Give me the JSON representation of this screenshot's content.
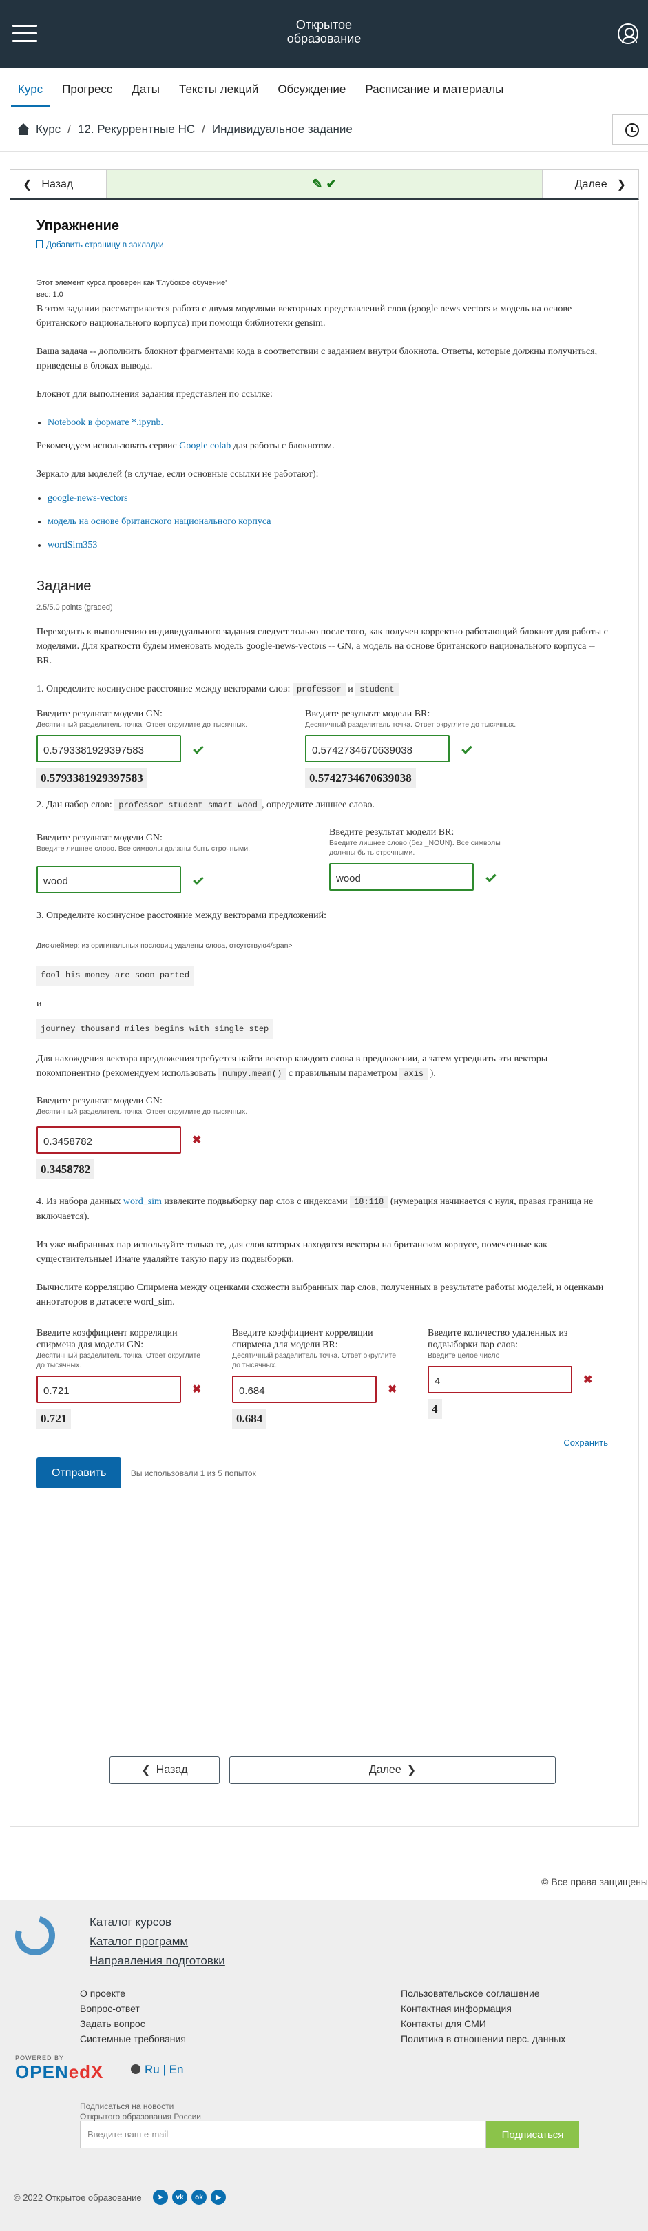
{
  "header": {
    "logo_line1": "Открытое",
    "logo_line2": "образование"
  },
  "course_nav": [
    "Курс",
    "Прогресс",
    "Даты",
    "Тексты лекций",
    "Обсуждение",
    "Расписание и материалы"
  ],
  "breadcrumb": [
    "Курс",
    "12. Рекуррентные НС",
    "Индивидуальное задание"
  ],
  "seq": {
    "prev": "Назад",
    "next": "Далее"
  },
  "exercise": {
    "title": "Упражнение",
    "bookmark": "Добавить страницу в закладки",
    "checked": "Этот элемент курса проверен как 'Глубокое обучение'",
    "weight": "вес: 1.0",
    "p1": "В этом задании рассматривается работа с двумя моделями векторных представлений слов (google news vectors и модель на основе британского национального корпуса) при помощи библиотеки gensim.",
    "p2": "Ваша задача -- дополнить блокнот фрагментами кода в соответствии с заданием внутри блокнота. Ответы, которые должны получиться, приведены в блоках вывода.",
    "p3": "Блокнот для выполнения задания представлен по ссылке:",
    "notebook_link": "Notebook в формате *.ipynb.",
    "p4_a": "Рекомендуем использовать сервис ",
    "p4_link": "Google colab",
    "p4_b": " для работы с блокнотом.",
    "p5": "Зеркало для моделей (в случае, если основные ссылки не работают):",
    "mirrors": [
      "google-news-vectors",
      "модель на основе британского национального корпуса",
      "wordSim353"
    ]
  },
  "task": {
    "title": "Задание",
    "points": "2.5/5.0 points (graded)",
    "intro": "Переходить к выполнению индивидуального задания следует только после того, как получен корректно работающий блокнот для работы с моделями. Для краткости будем именовать модель google-news-vectors -- GN, а модель на основе британского национального корпуса -- BR.",
    "q1": "1. Определите косинусное расстояние между векторами слов:",
    "q1_w1": "professor",
    "q1_and": "и",
    "q1_w2": "student",
    "gn_label": "Введите результат модели GN:",
    "br_label": "Введите результат модели BR:",
    "hint_decimal": "Десятичный разделитель точка. Ответ округлите до тысячных.",
    "q1_gn": "0.5793381929397583",
    "q1_br": "0.5742734670639038",
    "q2_a": "2. Дан набор слов:",
    "q2_words": "professor student smart wood",
    "q2_b": ", определите лишнее слово.",
    "hint_word_gn": "Введите лишнее слово. Все символы должны быть строчными.",
    "hint_word_br": "Введите лишнее слово (без _NOUN). Все символы должны быть строчными.",
    "q2_gn": "wood",
    "q2_br": "wood",
    "q3": "3. Определите косинусное расстояние между векторами предложений:",
    "q3_disclaimer": "Дисклеймер: из оригинальных пословиц удалены слова, отсутствую4/span>",
    "q3_s1": "fool his money are soon parted",
    "q3_and": "и",
    "q3_s2": "journey thousand miles begins with single step",
    "q3_text_a": "Для нахождения вектора предложения требуется найти вектор каждого слова в предложении, а затем усреднить эти векторы покомпонентно (рекомендуем использовать",
    "q3_code1": "numpy.mean()",
    "q3_text_b": "с правильным параметром",
    "q3_code2": "axis",
    "q3_text_c": ").",
    "q3_gn": "0.3458782",
    "q4_a": "4. Из набора данных",
    "q4_link": "word_sim",
    "q4_b": "извлеките подвыборку пар слов с индексами",
    "q4_code": "18:118",
    "q4_c": "(нумерация начинается с нуля, правая граница не включается).",
    "q4_p2": "Из уже выбранных пар используйте только те, для слов которых находятся векторы на британском корпусе, помеченные как существительные! Иначе удаляйте такую пару из подвыборки.",
    "q4_p3": "Вычислите корреляцию Спирмена между оценками схожести выбранных пар слов, полученных в результате работы моделей, и оценками аннотаторов в датасете word_sim.",
    "corr_gn_label": "Введите коэффициент корреляции спирмена для модели GN:",
    "corr_br_label": "Введите коэффициент корреляции спирмена для модели BR:",
    "removed_label": "Введите количество удаленных из подвыборки пар слов:",
    "hint_int": "Введите целое число",
    "q4_gn": "0.721",
    "q4_br": "0.684",
    "q4_removed": "4",
    "save": "Сохранить",
    "submit": "Отправить",
    "attempts": "Вы использовали 1 из 5 попыток"
  },
  "bottom_nav": {
    "prev": "Назад",
    "next": "Далее"
  },
  "footer": {
    "rights": "© Все права защищены",
    "catalog": [
      "Каталог курсов",
      "Каталог программ",
      "Направления подготовки"
    ],
    "col1": [
      "О проекте",
      "Вопрос-ответ",
      "Задать вопрос",
      "Системные требования"
    ],
    "col2": [
      "Пользовательское соглашение",
      "Контактная информация",
      "Контакты для СМИ",
      "Политика в отношении перс. данных"
    ],
    "powered": "POWERED BY",
    "openedx": "OPEN",
    "openedx_x": "edX",
    "lang_ru": "Ru",
    "lang_sep": "|",
    "lang_en": "En",
    "news_1": "Подписаться на новости",
    "news_2": "Открытого образования России",
    "email_placeholder": "Введите ваш e-mail",
    "subscribe": "Подписаться",
    "copyright": "© 2022 Открытое образование"
  },
  "colors": {
    "header_bg": "#23333f",
    "accent": "#0a6fb0",
    "correct": "#2e8b2e",
    "incorrect": "#b01e2a",
    "subscribe": "#8bc34a"
  }
}
